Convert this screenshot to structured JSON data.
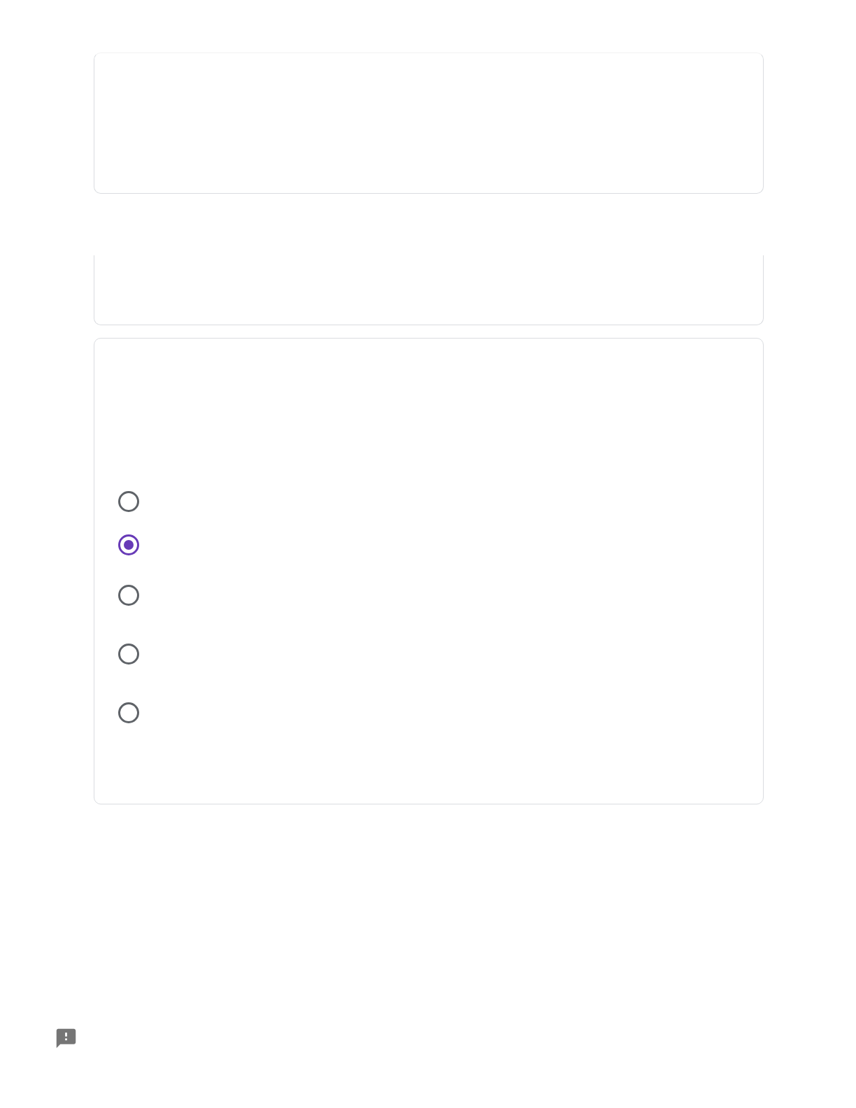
{
  "cards": [
    {
      "kind": "full"
    },
    {
      "kind": "cut_top"
    },
    {
      "kind": "question",
      "options": [
        {
          "selected": false
        },
        {
          "selected": true
        },
        {
          "selected": false
        },
        {
          "selected": false
        },
        {
          "selected": false
        }
      ]
    }
  ]
}
